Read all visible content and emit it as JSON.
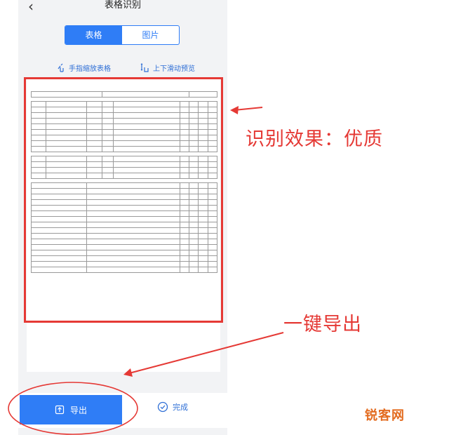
{
  "header": {
    "back_glyph": "‹",
    "title": "表格识别"
  },
  "tabs": [
    {
      "label": "表格",
      "active": true
    },
    {
      "label": "图片",
      "active": false
    }
  ],
  "hints": {
    "zoom": "手指缩放表格",
    "scroll": "上下滑动预览"
  },
  "bottom": {
    "export_label": "导出",
    "done_label": "完成"
  },
  "annotations": {
    "quality": "识别效果：优质",
    "export_note": "一键导出"
  },
  "watermark": "锐客网",
  "colors": {
    "accent": "#2f7df6",
    "annotation": "#e53935",
    "watermark": "#e36b1f"
  }
}
